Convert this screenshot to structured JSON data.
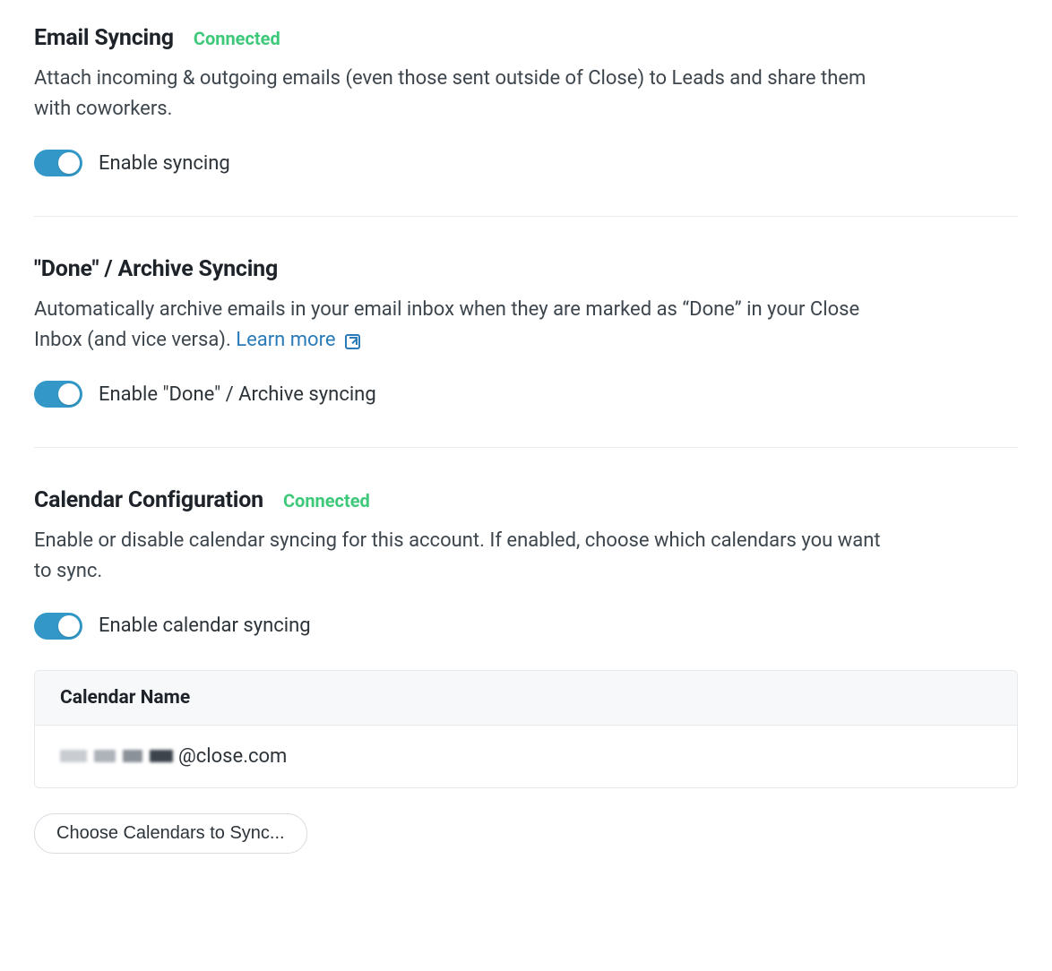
{
  "sections": {
    "email_syncing": {
      "title": "Email Syncing",
      "status": "Connected",
      "description": "Attach incoming & outgoing emails (even those sent outside of Close) to Leads and share them with coworkers.",
      "toggle_label": "Enable syncing",
      "toggle_on": true
    },
    "archive_syncing": {
      "title": "\"Done\" / Archive Syncing",
      "description_prefix": "Automatically archive emails in your email inbox when they are marked as “Done” in your Close Inbox (and vice versa). ",
      "learn_more_label": "Learn more",
      "toggle_label": "Enable \"Done\" / Archive syncing",
      "toggle_on": true
    },
    "calendar_config": {
      "title": "Calendar Configuration",
      "status": "Connected",
      "description": "Enable or disable calendar syncing for this account. If enabled, choose which calendars you want to sync.",
      "toggle_label": "Enable calendar syncing",
      "toggle_on": true,
      "table_header": "Calendar Name",
      "calendar_suffix": "@close.com",
      "choose_button": "Choose Calendars to Sync..."
    }
  }
}
